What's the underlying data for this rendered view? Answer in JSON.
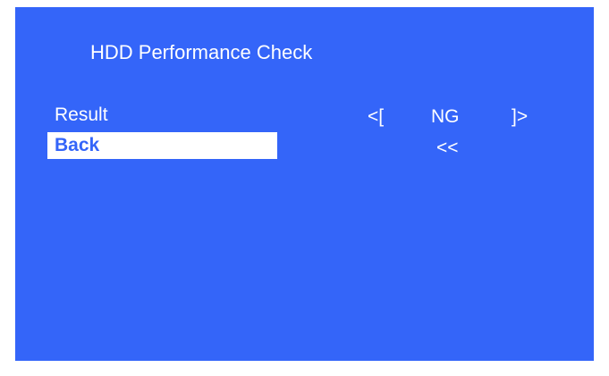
{
  "screen": {
    "title": "HDD Performance Check",
    "background_color": "#3465f9",
    "menu": {
      "result_label": "Result",
      "back_label": "Back"
    },
    "result_value": {
      "left_bracket": "<[",
      "status": "NG",
      "right_bracket": "]>"
    },
    "back_value": "<<"
  }
}
